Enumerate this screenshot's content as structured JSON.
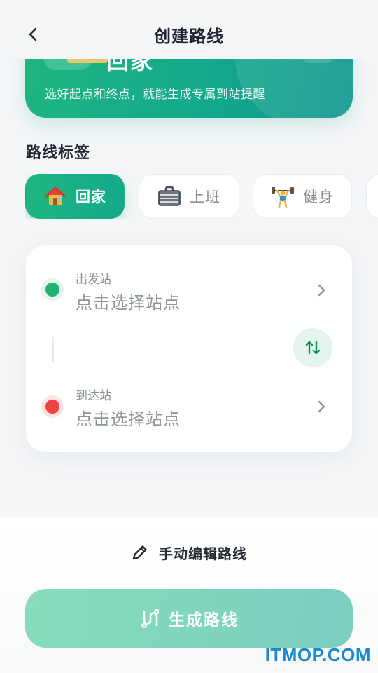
{
  "header": {
    "title": "创建路线",
    "back_icon": "chevron-left-icon"
  },
  "banner": {
    "title": "回家",
    "subtitle": "选好起点和终点，就能生成专属到站提醒"
  },
  "tags_section": {
    "label": "路线标签",
    "tags": [
      {
        "label": "回家",
        "icon": "house-icon",
        "selected": true
      },
      {
        "label": "上班",
        "icon": "briefcase-icon",
        "selected": false
      },
      {
        "label": "健身",
        "icon": "weightlifter-icon",
        "selected": false
      }
    ]
  },
  "route": {
    "departure": {
      "label": "出发站",
      "placeholder": "点击选择站点"
    },
    "arrival": {
      "label": "到达站",
      "placeholder": "点击选择站点"
    },
    "swap_icon": "swap-vertical-icon"
  },
  "actions": {
    "manual_edit": "手动编辑路线",
    "generate": "生成路线"
  },
  "watermark": "ITMOP.COM",
  "colors": {
    "accent": "#1fb680",
    "start_dot": "#1db36f",
    "end_dot": "#ef4444"
  }
}
